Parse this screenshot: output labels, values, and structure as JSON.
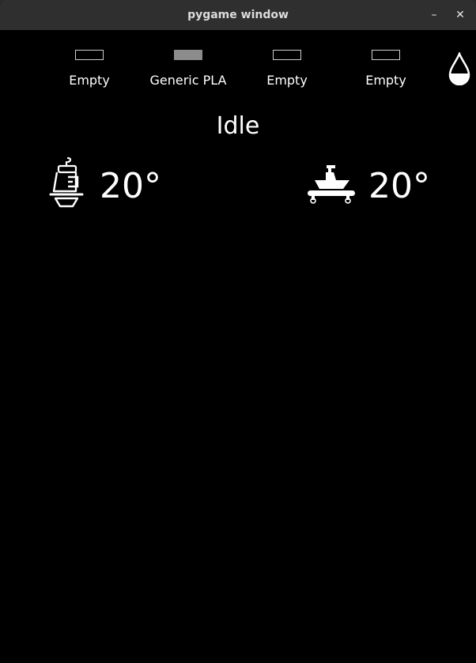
{
  "window": {
    "title": "pygame window",
    "minimize_glyph": "–",
    "close_glyph": "✕"
  },
  "filament_slots": [
    {
      "label": "Empty",
      "loaded": false
    },
    {
      "label": "Generic PLA",
      "loaded": true,
      "color": "#8c8c8c"
    },
    {
      "label": "Empty",
      "loaded": false
    },
    {
      "label": "Empty",
      "loaded": false
    }
  ],
  "status": "Idle",
  "hotend": {
    "temperature": "20°",
    "icon": "hotend-icon"
  },
  "bed": {
    "temperature": "20°",
    "icon": "bed-boat-icon"
  },
  "filament_icon": "droplet-icon"
}
